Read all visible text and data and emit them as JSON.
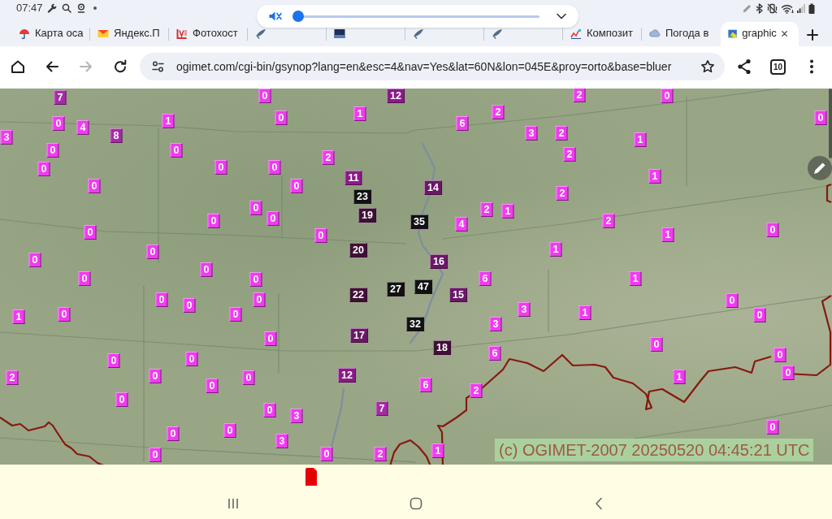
{
  "status_bar": {
    "time": "07:47"
  },
  "volume_popup": {
    "muted": true,
    "level": 0
  },
  "tabs": [
    {
      "label": "Карта оса",
      "selected": false
    },
    {
      "label": "Яндекс.П",
      "selected": false
    },
    {
      "label": "Фотохост",
      "selected": false
    },
    {
      "selected": false
    },
    {
      "selected": false
    },
    {
      "selected": false
    },
    {
      "selected": false
    },
    {
      "label": "Композит",
      "selected": false
    },
    {
      "label": "Погода в",
      "selected": false
    },
    {
      "label": "graphic",
      "selected": true
    }
  ],
  "toolbar": {
    "forward": {
      "disabled": true
    },
    "url": "ogimet.com/cgi-bin/gsynop?lang=en&esc=4&nav=Yes&lat=60N&lon=045E&proy=orto&base=bluer",
    "tab_count": "10"
  },
  "map": {
    "markers": [
      {
        "value": "7",
        "color": "#a52ca5"
      },
      {
        "value": "0",
        "color": "#f03cf0"
      },
      {
        "value": "12",
        "color": "#8a1a88"
      },
      {
        "value": "2",
        "color": "#f03cf0"
      },
      {
        "value": "0",
        "color": "#f03cf0"
      },
      {
        "value": "0",
        "color": "#f03cf0"
      },
      {
        "value": "4",
        "color": "#f03cf0"
      },
      {
        "value": "1",
        "color": "#f03cf0"
      },
      {
        "value": "0",
        "color": "#f03cf0"
      },
      {
        "value": "1",
        "color": "#f03cf0"
      },
      {
        "value": "6",
        "color": "#f03cf0"
      },
      {
        "value": "2",
        "color": "#f03cf0"
      },
      {
        "value": "0",
        "color": "#f03cf0"
      },
      {
        "value": "3",
        "color": "#f03cf0"
      },
      {
        "value": "8",
        "color": "#a52ca5"
      },
      {
        "value": "3",
        "color": "#f03cf0"
      },
      {
        "value": "2",
        "color": "#f03cf0"
      },
      {
        "value": "1",
        "color": "#f03cf0"
      },
      {
        "value": "0",
        "color": "#f03cf0"
      },
      {
        "value": "0",
        "color": "#f03cf0"
      },
      {
        "value": "2",
        "color": "#f03cf0"
      },
      {
        "value": "2",
        "color": "#f03cf0"
      },
      {
        "value": "0",
        "color": "#f03cf0"
      },
      {
        "value": "0",
        "color": "#f03cf0"
      },
      {
        "value": "0",
        "color": "#f03cf0"
      },
      {
        "value": "11",
        "color": "#8a1a88"
      },
      {
        "value": "1",
        "color": "#f03cf0"
      },
      {
        "value": "0",
        "color": "#f03cf0"
      },
      {
        "value": "0",
        "color": "#f03cf0"
      },
      {
        "value": "23",
        "color": "#111111"
      },
      {
        "value": "14",
        "color": "#6a1866"
      },
      {
        "value": "2",
        "color": "#f03cf0"
      },
      {
        "value": "0",
        "color": "#f03cf0"
      },
      {
        "value": "0",
        "color": "#f03cf0"
      },
      {
        "value": "0",
        "color": "#f03cf0"
      },
      {
        "value": "19",
        "color": "#401036"
      },
      {
        "value": "35",
        "color": "#111111"
      },
      {
        "value": "4",
        "color": "#f03cf0"
      },
      {
        "value": "2",
        "color": "#f03cf0"
      },
      {
        "value": "1",
        "color": "#f03cf0"
      },
      {
        "value": "2",
        "color": "#f03cf0"
      },
      {
        "value": "0",
        "color": "#f03cf0"
      },
      {
        "value": "0",
        "color": "#f03cf0"
      },
      {
        "value": "1",
        "color": "#f03cf0"
      },
      {
        "value": "0",
        "color": "#f03cf0"
      },
      {
        "value": "0",
        "color": "#f03cf0"
      },
      {
        "value": "20",
        "color": "#401036"
      },
      {
        "value": "1",
        "color": "#f03cf0"
      },
      {
        "value": "0",
        "color": "#f03cf0"
      },
      {
        "value": "0",
        "color": "#f03cf0"
      },
      {
        "value": "16",
        "color": "#6a1866"
      },
      {
        "value": "0",
        "color": "#f03cf0"
      },
      {
        "value": "0",
        "color": "#f03cf0"
      },
      {
        "value": "6",
        "color": "#f03cf0"
      },
      {
        "value": "1",
        "color": "#f03cf0"
      },
      {
        "value": "0",
        "color": "#f03cf0"
      },
      {
        "value": "0",
        "color": "#f03cf0"
      },
      {
        "value": "0",
        "color": "#f03cf0"
      },
      {
        "value": "22",
        "color": "#401036"
      },
      {
        "value": "27",
        "color": "#111111"
      },
      {
        "value": "47",
        "color": "#111111"
      },
      {
        "value": "15",
        "color": "#6a1866"
      },
      {
        "value": "0",
        "color": "#f03cf0"
      },
      {
        "value": "1",
        "color": "#f03cf0"
      },
      {
        "value": "0",
        "color": "#f03cf0"
      },
      {
        "value": "0",
        "color": "#f03cf0"
      },
      {
        "value": "3",
        "color": "#f03cf0"
      },
      {
        "value": "1",
        "color": "#f03cf0"
      },
      {
        "value": "0",
        "color": "#f03cf0"
      },
      {
        "value": "32",
        "color": "#111111"
      },
      {
        "value": "3",
        "color": "#f03cf0"
      },
      {
        "value": "0",
        "color": "#f03cf0"
      },
      {
        "value": "17",
        "color": "#6a1866"
      },
      {
        "value": "18",
        "color": "#401036"
      },
      {
        "value": "0",
        "color": "#f03cf0"
      },
      {
        "value": "0",
        "color": "#f03cf0"
      },
      {
        "value": "0",
        "color": "#f03cf0"
      },
      {
        "value": "6",
        "color": "#f03cf0"
      },
      {
        "value": "0",
        "color": "#f03cf0"
      },
      {
        "value": "2",
        "color": "#f03cf0"
      },
      {
        "value": "0",
        "color": "#f03cf0"
      },
      {
        "value": "0",
        "color": "#f03cf0"
      },
      {
        "value": "12",
        "color": "#8a1a88"
      },
      {
        "value": "1",
        "color": "#f03cf0"
      },
      {
        "value": "0",
        "color": "#f03cf0"
      },
      {
        "value": "0",
        "color": "#f03cf0"
      },
      {
        "value": "6",
        "color": "#f03cf0"
      },
      {
        "value": "2",
        "color": "#f03cf0"
      },
      {
        "value": "0",
        "color": "#f03cf0"
      },
      {
        "value": "0",
        "color": "#f03cf0"
      },
      {
        "value": "3",
        "color": "#f03cf0"
      },
      {
        "value": "7",
        "color": "#a52ca5"
      },
      {
        "value": "0",
        "color": "#f03cf0"
      },
      {
        "value": "0",
        "color": "#f03cf0"
      },
      {
        "value": "3",
        "color": "#f03cf0"
      },
      {
        "value": "0",
        "color": "#f03cf0"
      },
      {
        "value": "0",
        "color": "#f03cf0"
      },
      {
        "value": "0",
        "color": "#f03cf0"
      },
      {
        "value": "2",
        "color": "#f03cf0"
      },
      {
        "value": "1",
        "color": "#f03cf0"
      }
    ],
    "credit": "(c) OGIMET-2007 20250520 04:45:21 UTC"
  }
}
